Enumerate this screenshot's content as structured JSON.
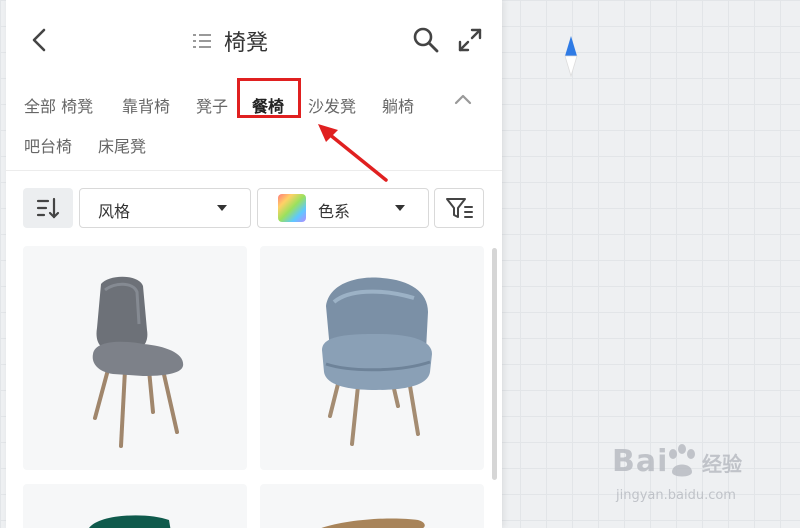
{
  "header": {
    "title": "椅凳",
    "back_icon": "chevron-left-icon",
    "list_icon": "list-icon",
    "search_icon": "search-icon",
    "expand_icon": "expand-icon"
  },
  "categories": [
    {
      "label": "全部 椅凳"
    },
    {
      "label": "靠背椅"
    },
    {
      "label": "凳子"
    },
    {
      "label": "餐椅"
    },
    {
      "label": "沙发凳"
    },
    {
      "label": "躺椅"
    },
    {
      "label": "吧台椅"
    },
    {
      "label": "床尾凳"
    }
  ],
  "active_category": "餐椅",
  "filters": {
    "sort_icon": "sort-icon",
    "style_label": "风格",
    "color_label": "色系",
    "filter_icon": "filter-settings-icon"
  },
  "products": [
    {
      "name": "grey-dining-chair"
    },
    {
      "name": "blue-armchair"
    },
    {
      "name": "green-chair"
    },
    {
      "name": "wood-chair"
    }
  ],
  "colors": {
    "highlight": "#e02020",
    "compass_north": "#2f7be5"
  },
  "watermark": {
    "main": "Bai",
    "cn": "经验",
    "url": "jingyan.baidu.com"
  }
}
